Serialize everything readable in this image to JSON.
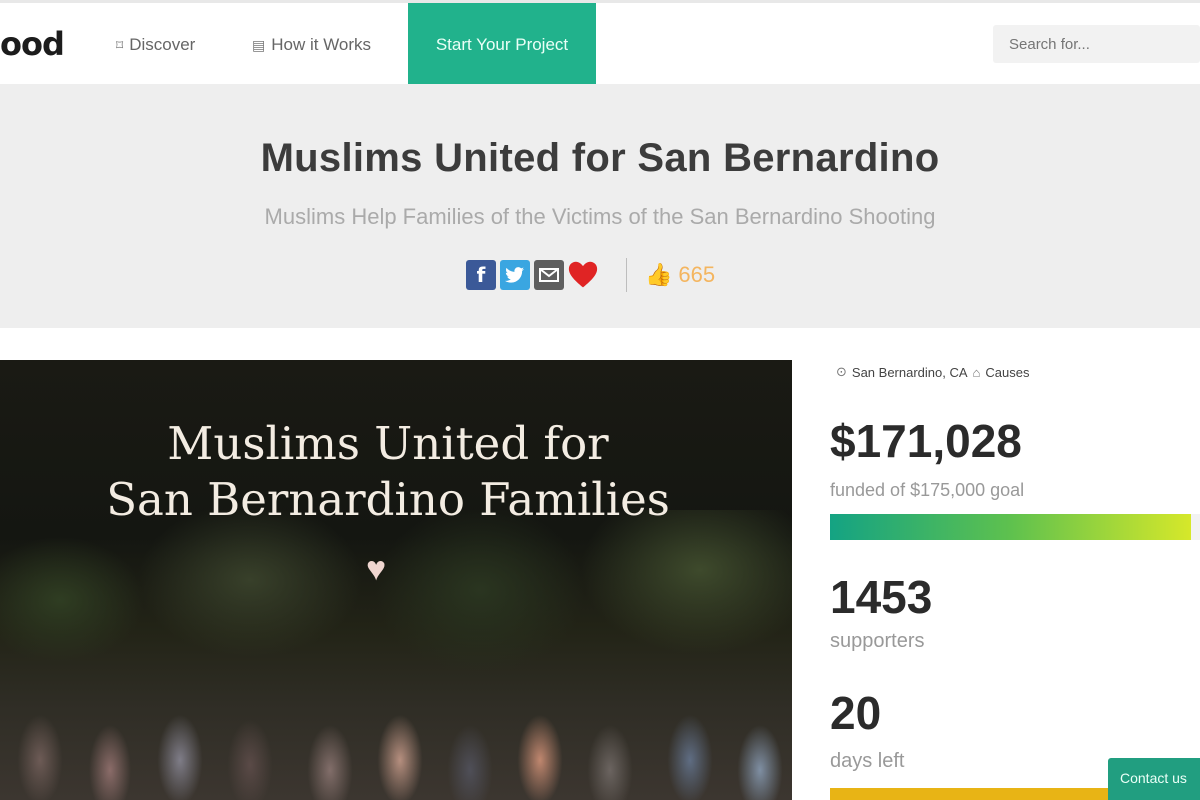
{
  "nav": {
    "logo": "ood",
    "discover": "Discover",
    "how_it_works": "How it Works",
    "start_project": "Start Your Project",
    "search_placeholder": "Search for..."
  },
  "campaign": {
    "title": "Muslims United for San Bernardino",
    "subtitle": "Muslims Help Families of the Victims of the San Bernardino Shooting",
    "likes": "665",
    "image_line1": "Muslims United for",
    "image_line2": "San Bernardino Families"
  },
  "stats": {
    "location": "San Bernardino, CA",
    "category": "Causes",
    "amount": "$171,028",
    "goal_text": "funded of $175,000 goal",
    "progress_fraction": 0.977,
    "supporters": "1453",
    "supporters_label": "supporters",
    "days": "20",
    "days_label": "days left"
  },
  "footer": {
    "contact": "Contact us"
  },
  "icons": {
    "facebook": "facebook-icon",
    "twitter": "twitter-icon",
    "email": "email-icon",
    "heart": "heart-icon",
    "like": "thumbs-up-icon",
    "location": "map-pin-icon",
    "category": "tag-icon"
  },
  "colors": {
    "accent": "#21b28c",
    "facebook": "#3b5998",
    "twitter": "#3aa6e1",
    "heart": "#e02424",
    "likes": "#f4b55f",
    "cta": "#e8b415"
  }
}
